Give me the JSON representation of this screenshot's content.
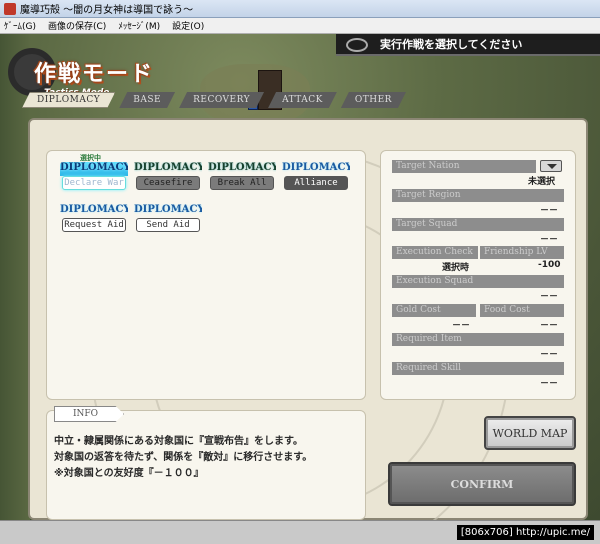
{
  "window": {
    "title": "魔導巧殻 ～闇の月女神は導国で詠う～",
    "menu": [
      "ｹﾞｰﾑ(G)",
      "画像の保存(C)",
      "ﾒｯｾｰｼﾞ(M)",
      "設定(O)"
    ]
  },
  "mode": {
    "title": "作戦モード",
    "subtitle": "Tactics Mode"
  },
  "instruction": "実行作戦を選択してください",
  "tabs": [
    "DIPLOMACY",
    "BASE",
    "RECOVERY",
    "ATTACK",
    "OTHER"
  ],
  "active_tab": "DIPLOMACY",
  "commands": [
    {
      "category": "DIPLOMACY",
      "label": "Declare War",
      "state": "selected"
    },
    {
      "category": "DIPLOMACY",
      "label": "Ceasefire",
      "state": "disabled"
    },
    {
      "category": "DIPLOMACY",
      "label": "Break All",
      "state": "disabled"
    },
    {
      "category": "DIPLOMACY",
      "label": "Alliance",
      "state": "enabled"
    },
    {
      "category": "DIPLOMACY",
      "label": "Request Aid",
      "state": "enabled"
    },
    {
      "category": "DIPLOMACY",
      "label": "Send Aid",
      "state": "enabled"
    }
  ],
  "selected_tag": "選択中",
  "details": {
    "target_nation": {
      "label": "Target Nation",
      "value": "未選択"
    },
    "target_region": {
      "label": "Target Region",
      "value": "－－"
    },
    "target_squad": {
      "label": "Target Squad",
      "value": "－－"
    },
    "execution_check": {
      "label": "Execution Check",
      "value": "選択時"
    },
    "friendship_lv": {
      "label": "Friendship LV",
      "value": "-100"
    },
    "execution_squad": {
      "label": "Execution Squad",
      "value": "－－"
    },
    "gold_cost": {
      "label": "Gold Cost",
      "value": "－－"
    },
    "food_cost": {
      "label": "Food Cost",
      "value": "－－"
    },
    "required_item": {
      "label": "Required Item",
      "value": "－－"
    },
    "required_skill": {
      "label": "Required Skill",
      "value": "－－"
    }
  },
  "info": {
    "tag": "INFO",
    "lines": [
      "中立・隷属関係にある対象国に『宣戦布告』をします。",
      "対象国の返答を待たず、関係を『敵対』に移行させます。",
      "※対象国との友好度『－１００』"
    ]
  },
  "buttons": {
    "world_map": "WORLD MAP",
    "confirm": "CONFIRM"
  },
  "watermark": "[806x706] http://upic.me/"
}
